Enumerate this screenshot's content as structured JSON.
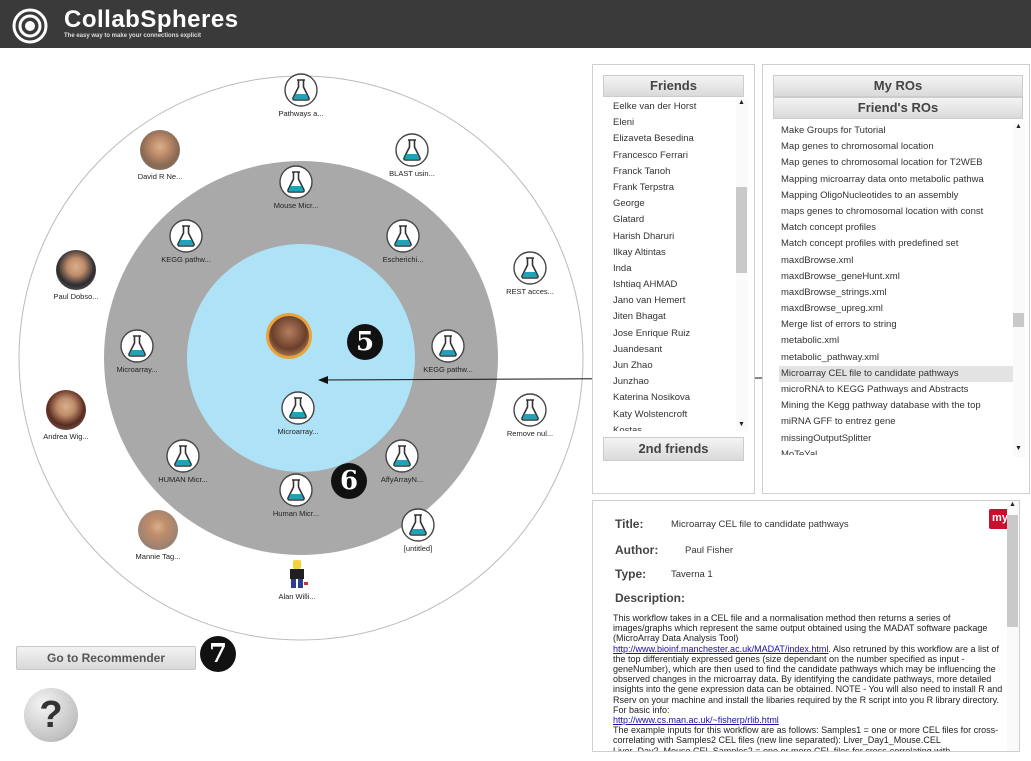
{
  "header": {
    "title": "CollabSpheres",
    "tagline": "The easy way to make your connections explicit"
  },
  "sphere": {
    "center_badge": "5",
    "ring_badge": "6",
    "center_nodes": [
      {
        "label": "Microarray...",
        "kind": "workflow"
      }
    ],
    "inner_ring_nodes": [
      {
        "label": "Mouse Micr...",
        "kind": "workflow"
      },
      {
        "label": "KEGG pathw...",
        "kind": "workflow"
      },
      {
        "label": "Escherichi...",
        "kind": "workflow"
      },
      {
        "label": "Microarray...",
        "kind": "workflow"
      },
      {
        "label": "KEGG pathw...",
        "kind": "workflow"
      },
      {
        "label": "HUMAN Micr...",
        "kind": "workflow"
      },
      {
        "label": "AffyArrayN...",
        "kind": "workflow"
      },
      {
        "label": "Human Micr...",
        "kind": "workflow"
      }
    ],
    "outer_ring_nodes": [
      {
        "label": "Pathways a...",
        "kind": "workflow"
      },
      {
        "label": "David R Ne...",
        "kind": "person"
      },
      {
        "label": "BLAST usin...",
        "kind": "workflow"
      },
      {
        "label": "Paul Dobso...",
        "kind": "person"
      },
      {
        "label": "REST acces...",
        "kind": "workflow"
      },
      {
        "label": "Andrea Wig...",
        "kind": "person"
      },
      {
        "label": "Remove nul...",
        "kind": "workflow"
      },
      {
        "label": "Mannie Tag...",
        "kind": "person"
      },
      {
        "label": "[untitled]",
        "kind": "workflow"
      },
      {
        "label": "Alan Willi...",
        "kind": "person"
      }
    ]
  },
  "friends_panel": {
    "title": "Friends",
    "items": [
      "Eelke van der Horst",
      "Eleni",
      "Elizaveta Besedina",
      "Francesco Ferrari",
      "Franck Tanoh",
      "Frank Terpstra",
      "George",
      "Glatard",
      "Harish Dharuri",
      "Ilkay Altintas",
      "Inda",
      "Ishtiaq AHMAD",
      "Jano van Hemert",
      "Jiten Bhagat",
      "Jose Enrique Ruiz",
      "Juandesant",
      "Jun Zhao",
      "Junzhao",
      "Katerina Nosikova",
      "Katy Wolstencroft",
      "Kostas"
    ],
    "second_friends_label": "2nd friends",
    "scroll_position": 0.35
  },
  "ros_panel": {
    "my_ros_label": "My ROs",
    "friends_ros_label": "Friend's ROs",
    "items": [
      "Make Groups for Tutorial",
      "Map genes to chromosomal location",
      "Map genes to chromosomal location for T2WEB",
      "Mapping microarray data onto metabolic pathwa",
      "Mapping OligoNucleotides to an assembly",
      "maps genes to chromosomal location with const",
      "Match concept profiles",
      "Match concept profiles with predefined set",
      "maxdBrowse.xml",
      "maxdBrowse_geneHunt.xml",
      "maxdBrowse_strings.xml",
      "maxdBrowse_upreg.xml",
      "Merge list of errors to string",
      "metabolic.xml",
      "metabolic_pathway.xml",
      "Microarray CEL file to candidate pathways",
      "microRNA to KEGG Pathways and Abstracts",
      "Mining the Kegg pathway database with the top",
      "miRNA GFF to entrez gene",
      "missingOutputSplitter",
      "MoTeYal"
    ],
    "selected_index": 15,
    "scroll_position": 0.55
  },
  "detail": {
    "title_label": "Title:",
    "title_value": "Microarray CEL file to candidate pathways",
    "author_label": "Author:",
    "author_value": "Paul Fisher",
    "type_label": "Type:",
    "type_value": "Taverna 1",
    "description_label": "Description:",
    "my_logo": "my",
    "desc_p1": "This workflow takes in a CEL file and a normalisation method then returns a series of images/graphs which represent the same output obtained using the MADAT software package (MicroArray Data Analysis Tool)",
    "link1": "http://www.bioinf.manchester.ac.uk/MADAT/index.html",
    "desc_p2": ". Also retruned by this workflow are a list of the top differentialy expressed genes (size dependant on the number specified as input - geneNumber), which are then used to find the candidate pathways which may be influencing the observed changes in the microarray data. By identifying the candidate pathways, more detailed insights into the gene expression data can be obtained. NOTE - You will also need to install R and Rserv on your machine and install the libaries required by the R script into you R library directory. For basic info:",
    "link2": "http://www.cs.man.ac.uk/~fisherp/rlib.html",
    "desc_p3": "The example inputs for this workflow are as follows: Samples1 = one or more CEL files for cross-correlating with Samples2 CEL files (new line separated): Liver_Day1_Mouse.CEL Liver_Day2_Mouse.CEL Samples2 = one or more CEL files for cross-correlating with"
  },
  "actions": {
    "go_to_recommender": "Go to Recommender",
    "recommender_badge": "7",
    "help_glyph": "?"
  },
  "colors": {
    "header_bg": "#3a3a3a",
    "inner_ring": "#a9a9a9",
    "center_circle": "#aee2f6",
    "flask_liquid": "#20a2b8"
  }
}
